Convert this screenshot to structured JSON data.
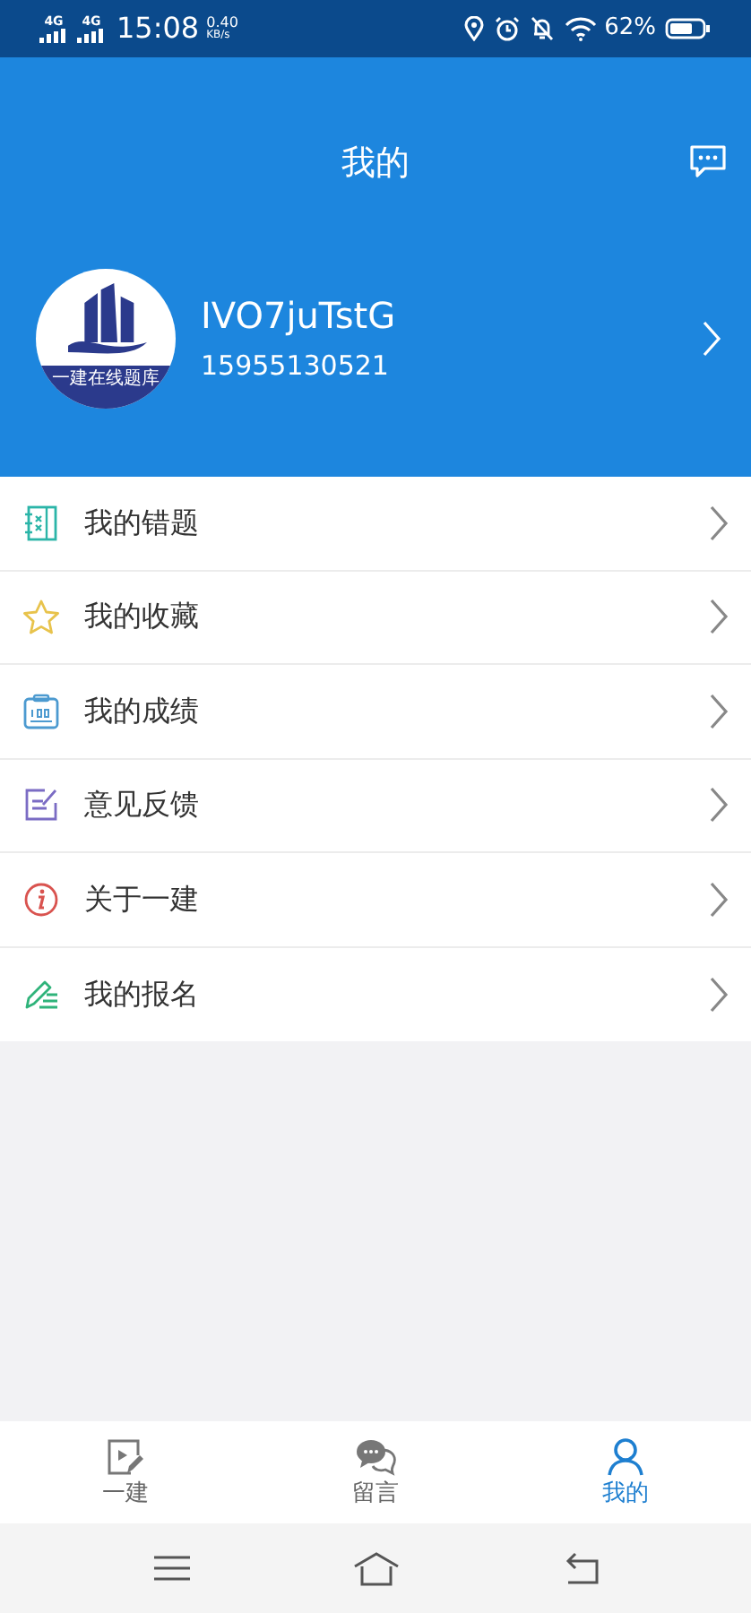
{
  "status_bar": {
    "network_1": "4G",
    "network_2": "4G",
    "time": "15:08",
    "speed_value": "0.40",
    "speed_unit": "KB/s",
    "battery": "62%"
  },
  "header": {
    "title": "我的"
  },
  "profile": {
    "avatar_caption": "一建在线题库",
    "username": "IVO7juTstG",
    "phone": "15955130521"
  },
  "menu": [
    {
      "kind": "wrong",
      "label": "我的错题"
    },
    {
      "kind": "favorite",
      "label": "我的收藏"
    },
    {
      "kind": "score",
      "label": "我的成绩"
    },
    {
      "kind": "feedback",
      "label": "意见反馈"
    },
    {
      "kind": "about",
      "label": "关于一建"
    },
    {
      "kind": "signup",
      "label": "我的报名"
    }
  ],
  "tab_bar": [
    {
      "kind": "study",
      "label": "一建",
      "selected": false
    },
    {
      "kind": "chat",
      "label": "留言",
      "selected": false
    },
    {
      "kind": "profile",
      "label": "我的",
      "selected": true
    }
  ]
}
